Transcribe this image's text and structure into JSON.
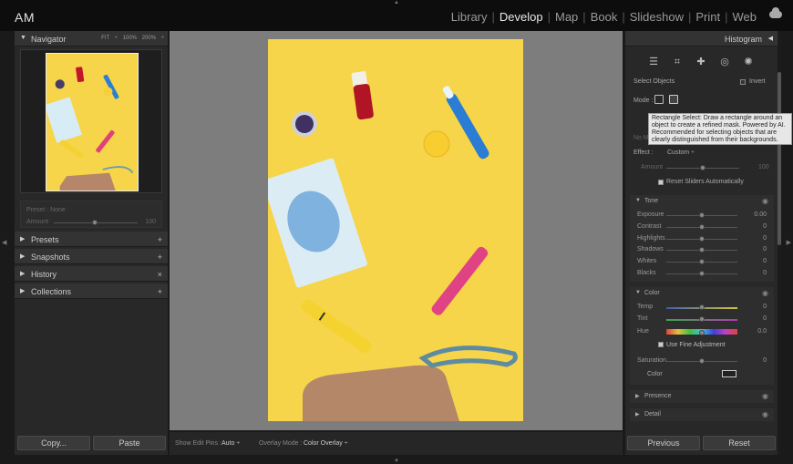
{
  "app": {
    "logo": "AM"
  },
  "modules": [
    "Library",
    "Develop",
    "Map",
    "Book",
    "Slideshow",
    "Print",
    "Web"
  ],
  "active_module": "Develop",
  "navigator": {
    "title": "Navigator",
    "opts": "FIT ÷   100%   200% ÷"
  },
  "preset": {
    "label": "Preset : None",
    "amount_label": "Amount",
    "amount_value": "100"
  },
  "left_panels": [
    {
      "label": "Presets",
      "action": "+"
    },
    {
      "label": "Snapshots",
      "action": "+"
    },
    {
      "label": "History",
      "action": "×"
    },
    {
      "label": "Collections",
      "action": "+"
    }
  ],
  "left_buttons": {
    "copy": "Copy...",
    "paste": "Paste"
  },
  "toolbar": {
    "edit_pins_label": "Show Edit Pins :",
    "edit_pins_value": "Auto ÷",
    "overlay_label": "Overlay Mode :",
    "overlay_value": "Color Overlay ÷"
  },
  "right": {
    "histogram_title": "Histogram",
    "select_objects": "Select Objects",
    "invert": "Invert",
    "mode": "Mode :",
    "tooltip": "Rectangle Select: Draw a rectangle around an object to create a refined mask. Powered by AI. Recommended for selecting objects that are clearly distinguished from their backgrounds.",
    "no_mask": "No M",
    "effect_label": "Effect :",
    "effect_value": "Custom ÷",
    "amount_label": "Amount",
    "amount_value": "100",
    "reset_sliders": "Reset Sliders Automatically"
  },
  "tone": {
    "title": "Tone",
    "rows": [
      {
        "name": "Exposure",
        "value": "0.00"
      },
      {
        "name": "Contrast",
        "value": "0"
      },
      {
        "name": "Highlights",
        "value": "0"
      },
      {
        "name": "Shadows",
        "value": "0"
      },
      {
        "name": "Whites",
        "value": "0"
      },
      {
        "name": "Blacks",
        "value": "0"
      }
    ]
  },
  "color": {
    "title": "Color",
    "temp": "Temp",
    "temp_value": "0",
    "tint": "Tint",
    "tint_value": "0",
    "hue": "Hue",
    "hue_value": "0.0",
    "fine": "Use Fine Adjustment",
    "saturation": "Saturation",
    "saturation_value": "0",
    "color_label": "Color"
  },
  "presence": {
    "title": "Presence"
  },
  "detail": {
    "title": "Detail"
  },
  "right_buttons": {
    "previous": "Previous",
    "reset": "Reset"
  }
}
